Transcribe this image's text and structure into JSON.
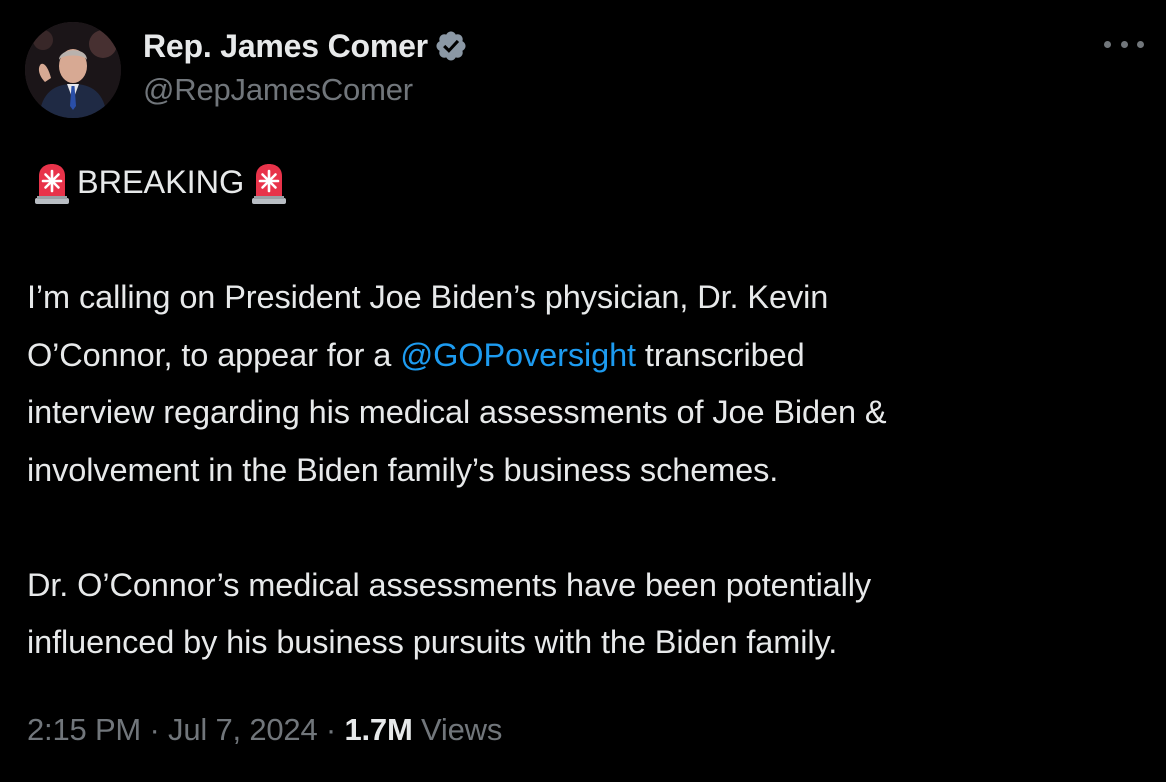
{
  "author": {
    "display_name": "Rep. James Comer",
    "handle": "@RepJamesComer",
    "verified": true
  },
  "tweet": {
    "headline": "BREAKING",
    "paragraph1": {
      "line1": "I’m calling on President Joe Biden’s physician, Dr. Kevin",
      "line2_before": "O’Connor, to appear for a ",
      "mention": "@GOPoversight",
      "line2_after": " transcribed",
      "line3": "interview regarding his medical assessments of Joe Biden &",
      "line4": "involvement in the Biden family’s business schemes."
    },
    "paragraph2": {
      "line1": "Dr. O’Connor’s medical assessments have been potentially",
      "line2": "influenced by his business pursuits with the Biden family."
    }
  },
  "meta": {
    "time": "2:15 PM",
    "separator": " · ",
    "date": "Jul 7, 2024",
    "views_count": "1.7M",
    "views_label": " Views"
  },
  "icons": {
    "avatar": "avatar-photo",
    "verified": "verified-badge-icon",
    "more": "more-options-icon",
    "siren": "police-light-emoji"
  },
  "colors": {
    "background": "#000000",
    "text": "#e7e9ea",
    "secondary": "#71767b",
    "link": "#1d9bf0",
    "verified": "#8b98a5",
    "siren": "#e8334a"
  }
}
